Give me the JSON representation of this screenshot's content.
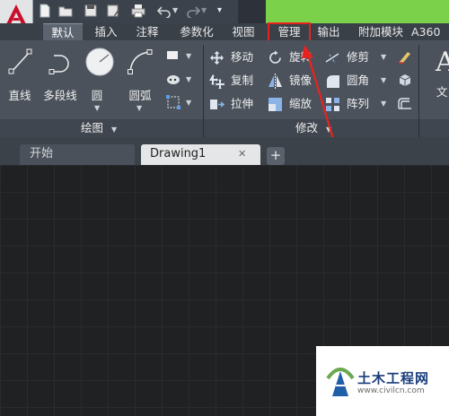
{
  "title_bar": {
    "quick_access_icons": [
      "new-icon",
      "open-icon",
      "save-icon",
      "save-as-icon",
      "print-icon",
      "undo-icon",
      "redo-icon",
      "customize-dropdown-icon"
    ]
  },
  "ribbon_tabs": [
    {
      "label": "默认",
      "active": true
    },
    {
      "label": "插入"
    },
    {
      "label": "注释"
    },
    {
      "label": "参数化"
    },
    {
      "label": "视图"
    },
    {
      "label": "管理",
      "highlighted": true
    },
    {
      "label": "输出"
    },
    {
      "label": "附加模块"
    },
    {
      "label": "A360"
    }
  ],
  "draw_panel": {
    "title": "绘图",
    "tools": [
      {
        "label": "直线",
        "icon": "line-icon"
      },
      {
        "label": "多段线",
        "icon": "polyline-icon"
      },
      {
        "label": "圆",
        "icon": "circle-icon"
      },
      {
        "label": "圆弧",
        "icon": "arc-icon"
      }
    ]
  },
  "modify_panel": {
    "title": "修改",
    "commands": [
      {
        "label": "移动",
        "icon": "move-icon"
      },
      {
        "label": "旋转",
        "icon": "rotate-icon"
      },
      {
        "label": "修剪",
        "icon": "trim-icon"
      },
      {
        "label": "复制",
        "icon": "copy-icon"
      },
      {
        "label": "镜像",
        "icon": "mirror-icon"
      },
      {
        "label": "圆角",
        "icon": "fillet-icon"
      },
      {
        "label": "拉伸",
        "icon": "stretch-icon"
      },
      {
        "label": "缩放",
        "icon": "scale-icon"
      },
      {
        "label": "阵列",
        "icon": "array-icon"
      }
    ]
  },
  "annotation_panel": {
    "partial_label": "文"
  },
  "document_tabs": [
    {
      "label": "开始"
    },
    {
      "label": "Drawing1",
      "active": true
    }
  ],
  "accent_colors": {
    "highlight_box": "#e8231f",
    "autocad_red": "#c8102e"
  },
  "watermark": {
    "title": "土木工程网",
    "url": "www.civilcn.com"
  }
}
